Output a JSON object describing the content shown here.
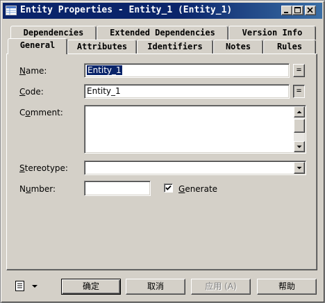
{
  "window": {
    "title": "Entity Properties - Entity_1 (Entity_1)",
    "minimize_glyph": "_",
    "maximize_glyph": "□",
    "close_glyph": "×"
  },
  "tabs": {
    "row_back": [
      {
        "label": "Dependencies"
      },
      {
        "label": "Extended Dependencies"
      },
      {
        "label": "Version Info"
      }
    ],
    "row_front": [
      {
        "label": "General",
        "active": true
      },
      {
        "label": "Attributes"
      },
      {
        "label": "Identifiers"
      },
      {
        "label": "Notes"
      },
      {
        "label": "Rules"
      }
    ]
  },
  "form": {
    "name": {
      "label_access": "N",
      "label_rest": "ame:",
      "value": "Entity_1",
      "selected": true
    },
    "code": {
      "label_access": "C",
      "label_rest": "ode:",
      "value": "Entity_1"
    },
    "comment": {
      "label_pre": "C",
      "label_access": "o",
      "label_rest": "mment:",
      "value": ""
    },
    "stereotype": {
      "label_access": "S",
      "label_rest": "tereotype:",
      "value": ""
    },
    "number": {
      "label_pre": "N",
      "label_access": "u",
      "label_rest": "mber:",
      "value": ""
    },
    "generate": {
      "label_access": "G",
      "label_rest": "enerate",
      "checked": true
    },
    "equals_glyph": "="
  },
  "footer": {
    "menu_icon": "property-menu-icon",
    "ok_label": "确定",
    "cancel_label": "取消",
    "apply_label": "应用 (A)",
    "help_label": "帮助"
  },
  "colors": {
    "titlebar": "#0a246a",
    "face": "#d4d0c8",
    "selection": "#0a246a"
  }
}
